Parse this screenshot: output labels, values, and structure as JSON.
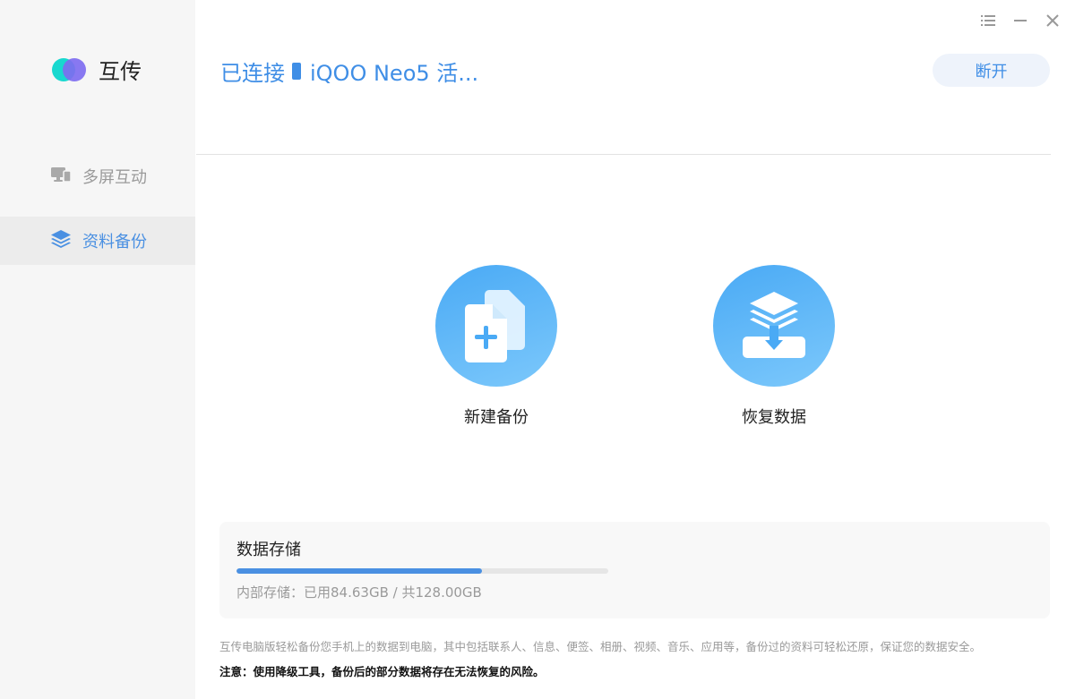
{
  "app": {
    "name": "互传"
  },
  "window": {
    "controls": [
      "menu-icon",
      "minimize-icon",
      "close-icon"
    ]
  },
  "sidebar": {
    "items": [
      {
        "label": "多屏互动",
        "icon": "monitor-phone-icon",
        "active": false
      },
      {
        "label": "资料备份",
        "icon": "layers-icon",
        "active": true
      }
    ]
  },
  "header": {
    "status": "已连接",
    "device_icon": "phone-icon",
    "device_name": "iQOO Neo5 活...",
    "disconnect_label": "断开"
  },
  "actions": [
    {
      "label": "新建备份",
      "icon": "new-backup-icon"
    },
    {
      "label": "恢复数据",
      "icon": "restore-data-icon"
    }
  ],
  "storage": {
    "title": "数据存储",
    "detail": "内部存储：已用84.63GB / 共128.00GB",
    "used_fraction": 0.661
  },
  "footer": {
    "info": "互传电脑版轻松备份您手机上的数据到电脑，其中包括联系人、信息、便签、相册、视频、音乐、应用等，备份过的资料可轻松还原，保证您的数据安全。",
    "warning": "注意：使用降级工具，备份后的部分数据将存在无法恢复的风险。"
  },
  "colors": {
    "accent": "#3f8ee6",
    "sidebar_bg": "#f6f6f6",
    "active_item_bg": "#ececec"
  }
}
